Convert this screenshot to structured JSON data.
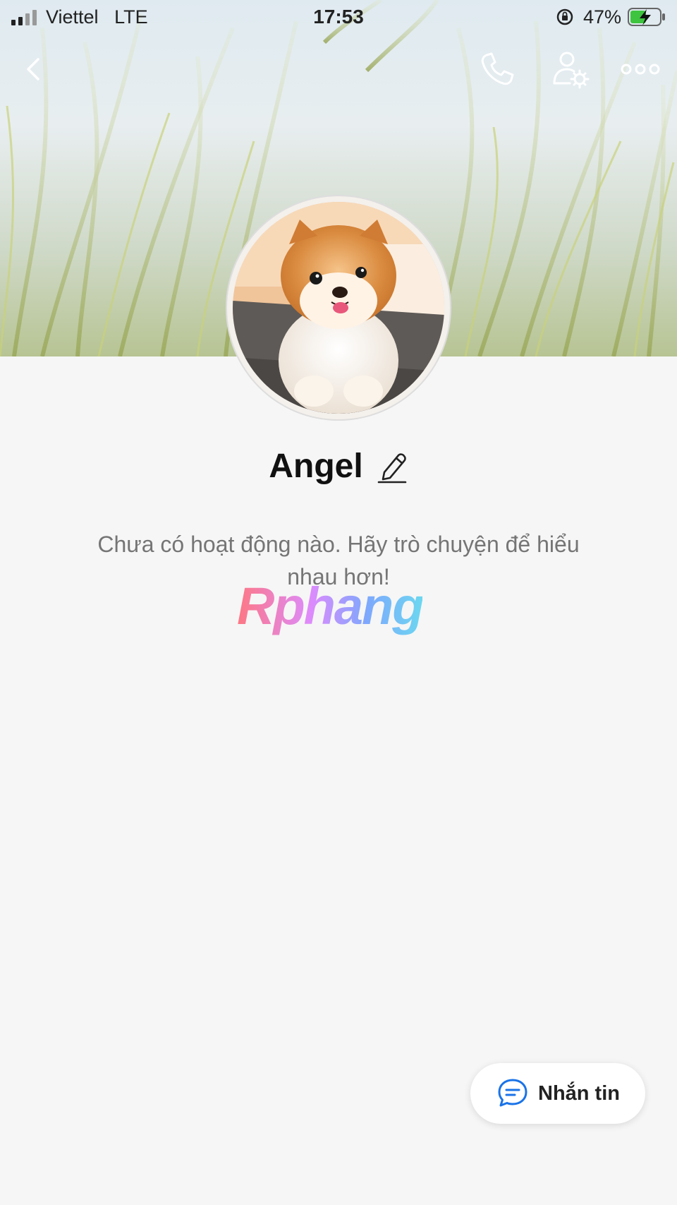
{
  "status_bar": {
    "carrier": "Viettel",
    "network": "LTE",
    "time": "17:53",
    "battery_percent": "47%"
  },
  "nav": {
    "back_icon": "chevron-left-icon",
    "call_icon": "phone-icon",
    "user_settings_icon": "user-gear-icon",
    "more_icon": "more-dots-icon"
  },
  "profile": {
    "name": "Angel",
    "edit_icon": "pencil-icon"
  },
  "empty_state": {
    "message": "Chưa có hoạt động nào. Hãy trò chuyện để hiểu nhau hơn!"
  },
  "watermark": {
    "text": "Rphang"
  },
  "actions": {
    "message_label": "Nhắn tin",
    "message_icon": "chat-bubble-icon"
  },
  "colors": {
    "accent": "#1a73e8",
    "background": "#f6f6f6",
    "text_muted": "#757575"
  }
}
